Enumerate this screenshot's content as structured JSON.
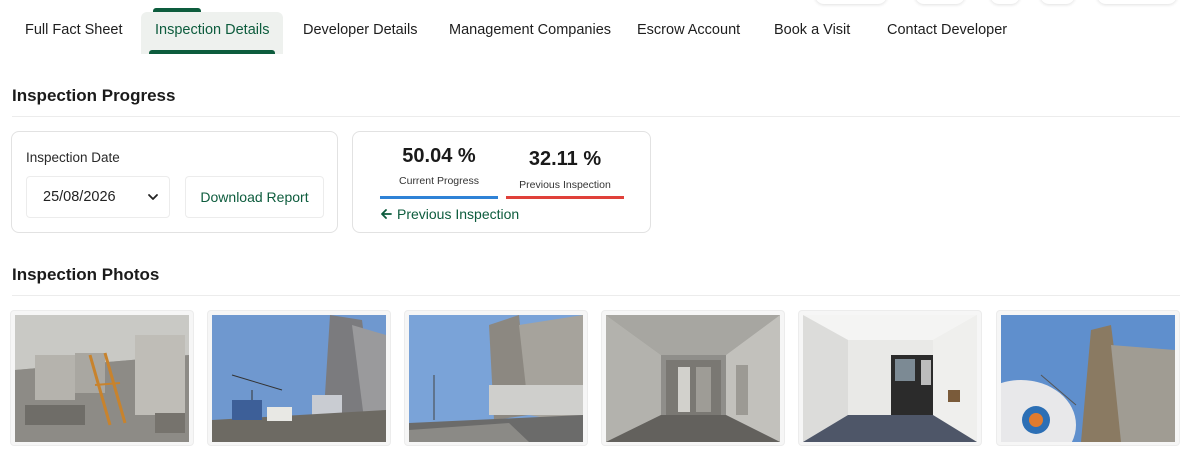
{
  "tabs": [
    {
      "label": "Full Fact Sheet",
      "active": false
    },
    {
      "label": "Inspection Details",
      "active": true
    },
    {
      "label": "Developer Details",
      "active": false
    },
    {
      "label": "Management Companies",
      "active": false
    },
    {
      "label": "Escrow Account",
      "active": false
    },
    {
      "label": "Book a Visit",
      "active": false
    },
    {
      "label": "Contact Developer",
      "active": false
    }
  ],
  "progress_section": {
    "title": "Inspection Progress",
    "date_label": "Inspection Date",
    "date_value": "25/08/2026",
    "download_label": "Download Report",
    "current_value": "50.04 %",
    "current_label": "Current Progress",
    "previous_value": "32.11 %",
    "previous_label": "Previous Inspection",
    "previous_link": "Previous Inspection",
    "current_fraction": 0.5004,
    "previous_fraction": 0.3211
  },
  "photos_section": {
    "title": "Inspection Photos",
    "photos": [
      {
        "subject": "interior-concrete-floor"
      },
      {
        "subject": "tower-exterior"
      },
      {
        "subject": "tower-exterior-road"
      },
      {
        "subject": "interior-corridor"
      },
      {
        "subject": "interior-unit-white"
      },
      {
        "subject": "tower-fisheye"
      }
    ]
  },
  "colors": {
    "brand_green": "#0d5c3d",
    "current_bar": "#2f82d6",
    "previous_bar": "#e0403a"
  }
}
